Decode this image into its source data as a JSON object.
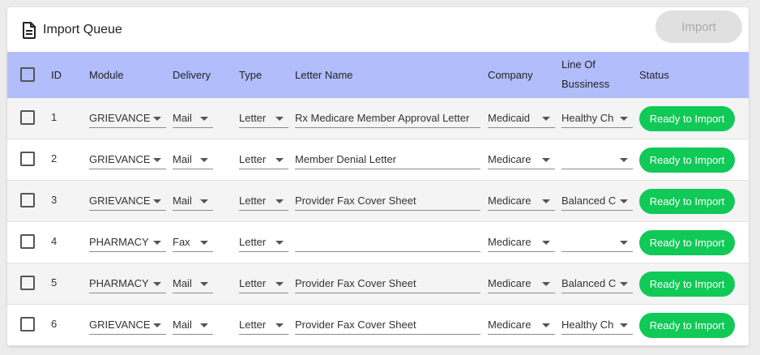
{
  "header": {
    "title": "Import Queue",
    "import_label": "Import",
    "doc_icon": "document-icon"
  },
  "columns": {
    "id": "ID",
    "module": "Module",
    "delivery": "Delivery",
    "type": "Type",
    "letter_name": "Letter Name",
    "company": "Company",
    "line_of_business_1": "Line Of",
    "line_of_business_2": "Bussiness",
    "status": "Status"
  },
  "rows": [
    {
      "id": "1",
      "module": "GRIEVANCE",
      "delivery": "Mail",
      "type": "Letter",
      "letter_name": "Rx Medicare Member Approval Letter",
      "company": "Medicaid",
      "line_of_business": "Healthy Ch",
      "status": "Ready to Import"
    },
    {
      "id": "2",
      "module": "GRIEVANCE",
      "delivery": "Mail",
      "type": "Letter",
      "letter_name": "Member Denial Letter",
      "company": "Medicare",
      "line_of_business": "",
      "status": "Ready to Import"
    },
    {
      "id": "3",
      "module": "GRIEVANCE",
      "delivery": "Mail",
      "type": "Letter",
      "letter_name": "Provider Fax Cover Sheet",
      "company": "Medicare",
      "line_of_business": "Balanced C",
      "status": "Ready to Import"
    },
    {
      "id": "4",
      "module": "PHARMACY",
      "delivery": "Fax",
      "type": "Letter",
      "letter_name": "",
      "company": "Medicare",
      "line_of_business": "",
      "status": "Ready to Import"
    },
    {
      "id": "5",
      "module": "PHARMACY",
      "delivery": "Mail",
      "type": "Letter",
      "letter_name": "Provider Fax Cover Sheet",
      "company": "Medicare",
      "line_of_business": "Balanced C",
      "status": "Ready to Import"
    },
    {
      "id": "6",
      "module": "GRIEVANCE",
      "delivery": "Mail",
      "type": "Letter",
      "letter_name": "Provider Fax Cover Sheet",
      "company": "Medicare",
      "line_of_business": "Healthy Ch",
      "status": "Ready to Import"
    }
  ],
  "colors": {
    "header_bg": "#b2bdfc",
    "status_green": "#10c957",
    "import_disabled_bg": "#e0e0e0"
  }
}
